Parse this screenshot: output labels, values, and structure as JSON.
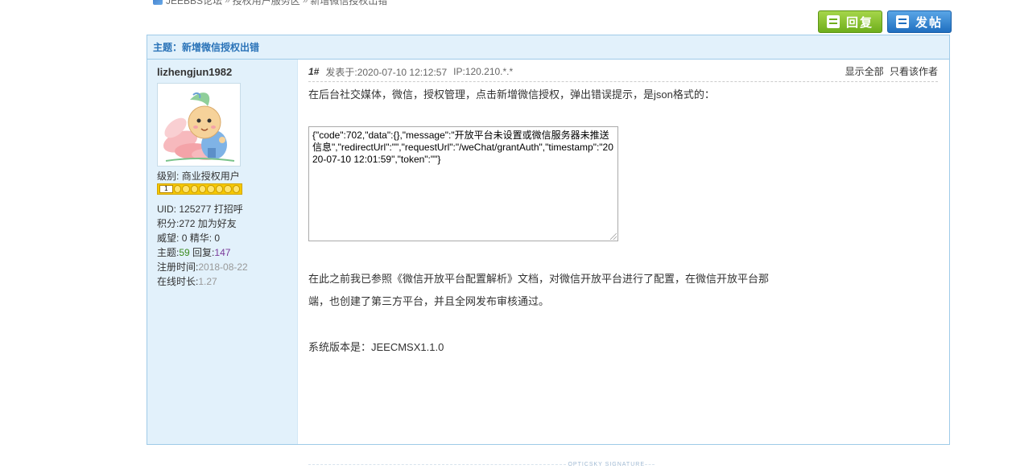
{
  "breadcrumb": {
    "items": [
      "JEEBBS论坛",
      "授权用户服务区",
      "新增微信授权出错"
    ],
    "separator": "»"
  },
  "actions": {
    "reply_label": "回复",
    "post_label": "发帖"
  },
  "thread": {
    "title": "主题：新增微信授权出错"
  },
  "author": {
    "username": "lizhengjun1982",
    "avatar": "cartoon-monk-avatar",
    "level_label": "级别:",
    "level_value": "商业授权用户",
    "badge_level": "1",
    "badge_stars": 8,
    "uid_label": "UID:",
    "uid": "125277",
    "greet_link": "打招呼",
    "points_label": "积分:",
    "points": "272",
    "add_friend_link": "加为好友",
    "prestige_label": "威望:",
    "prestige": "0",
    "essence_label": "精华:",
    "essence": "0",
    "topics_label": "主题:",
    "topics": "59",
    "replies_label": "回复:",
    "replies": "147",
    "register_label": "注册时间:",
    "register_date": "2018-08-22",
    "online_label": "在线时长:",
    "online_hours": "1.27"
  },
  "post": {
    "floor": "1#",
    "posted_at": "发表于:2020-07-10 12:12:57",
    "ip": "IP:120.210.*.*",
    "show_all": "显示全部",
    "only_author": "只看该作者",
    "paragraph1": "在后台社交媒体，微信，授权管理，点击新增微信授权，弹出错误提示，是json格式的：",
    "code": "{\"code\":702,\"data\":{},\"message\":\"开放平台未设置或微信服务器未推送信息\",\"redirectUrl\":\"\",\"requestUrl\":\"/weChat/grantAuth\",\"timestamp\":\"2020-07-10 12:01:59\",\"token\":\"\"}",
    "paragraph2": "在此之前我已参照《微信开放平台配置解析》文档，对微信开放平台进行了配置，在微信开放平台那端，也创建了第三方平台，并且全网发布审核通过。",
    "paragraph3": "系统版本是：JEECMSX1.1.0",
    "signature_label": "OPTICSKY SIGNATURE"
  },
  "colors": {
    "header_bg": "#e2f1fb",
    "border": "#9fcbe8",
    "title_blue": "#2a73b8",
    "reply_green": "#6fae1c",
    "post_blue": "#1f6fc0"
  }
}
